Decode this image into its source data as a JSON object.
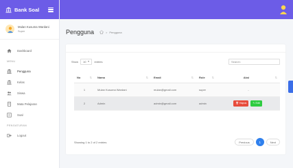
{
  "brand": {
    "name": "Bank Soal"
  },
  "user": {
    "name": "Mulan Kusuma Wardani",
    "role": "Super"
  },
  "nav": {
    "dashboard": "Dashboard",
    "header_menu": "MENU",
    "pengguna": "Pengguna",
    "kelas": "Kelas",
    "siswa": "Siswa",
    "mata_pelajaran": "Mata Pelajaran",
    "soal": "Soal",
    "header_pengaturan": "PENGATURAN",
    "logout": "Logout"
  },
  "page": {
    "title": "Pengguna",
    "breadcrumb_sep": ">",
    "breadcrumb_current": "Pengguna"
  },
  "controls": {
    "show_label": "Show",
    "entries_value": "10",
    "entries_label": "entries",
    "search_label": "Search:"
  },
  "table": {
    "headers": {
      "no": "No",
      "nama": "Nama",
      "email": "Email",
      "role": "Role",
      "aksi": "Aksi"
    },
    "rows": [
      {
        "no": "1",
        "nama": "Mulan Kusuma Wardani",
        "email": "mulan@gmail.com",
        "role": "super",
        "aksi": "-"
      },
      {
        "no": "2",
        "nama": "Admin",
        "email": "admin@gmail.com",
        "role": "admin",
        "delete_label": "Hapus",
        "edit_label": "Edit"
      }
    ]
  },
  "footer": {
    "info": "Showing 1 to 2 of 2 entries",
    "prev": "Previous",
    "current_page": "1",
    "next": "Next"
  },
  "colors": {
    "primary": "#6c5ce7",
    "danger": "#e74c3c",
    "success": "#2ecc40",
    "pager_active": "#2f80ed"
  },
  "icons": [
    "bank-icon",
    "menu-icon",
    "user-icon",
    "home-icon",
    "kelas-icon",
    "siswa-icon",
    "book-icon",
    "soal-icon",
    "logout-icon",
    "trash-icon",
    "pencil-icon"
  ]
}
